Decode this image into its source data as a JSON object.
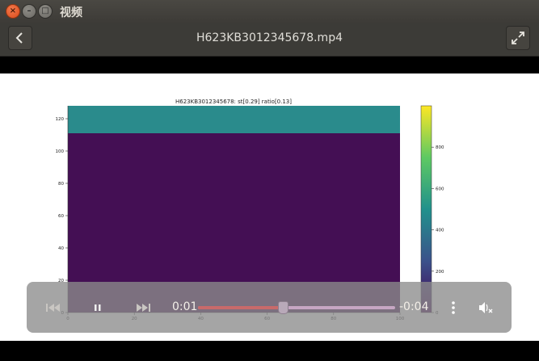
{
  "window": {
    "title": "视频"
  },
  "header": {
    "title": "H623KB3012345678.mp4"
  },
  "player": {
    "elapsed": "0:01",
    "remaining": "-0:04",
    "progress": 0.43
  },
  "chart_data": {
    "type": "heatmap",
    "title": "H623KB3012345678: st[0.29] ratio[0.13]",
    "xlim": [
      0,
      100
    ],
    "ylim": [
      0,
      128
    ],
    "x_ticks": [
      "0",
      "20",
      "40",
      "60",
      "80",
      "100"
    ],
    "y_ticks": [
      "0",
      "20",
      "40",
      "60",
      "80",
      "100",
      "120"
    ],
    "colorbar": {
      "min": 0,
      "max": 1000,
      "ticks": [
        "0",
        "200",
        "400",
        "600",
        "800"
      ],
      "colormap": "viridis"
    },
    "regions": [
      {
        "y_from": 0,
        "y_to": 111,
        "value": 0
      },
      {
        "y_from": 111,
        "y_to": 128,
        "value": 380
      }
    ]
  },
  "colors": {
    "low": "#440f54",
    "mid": "#2a8b8c",
    "high": "#fde725"
  }
}
